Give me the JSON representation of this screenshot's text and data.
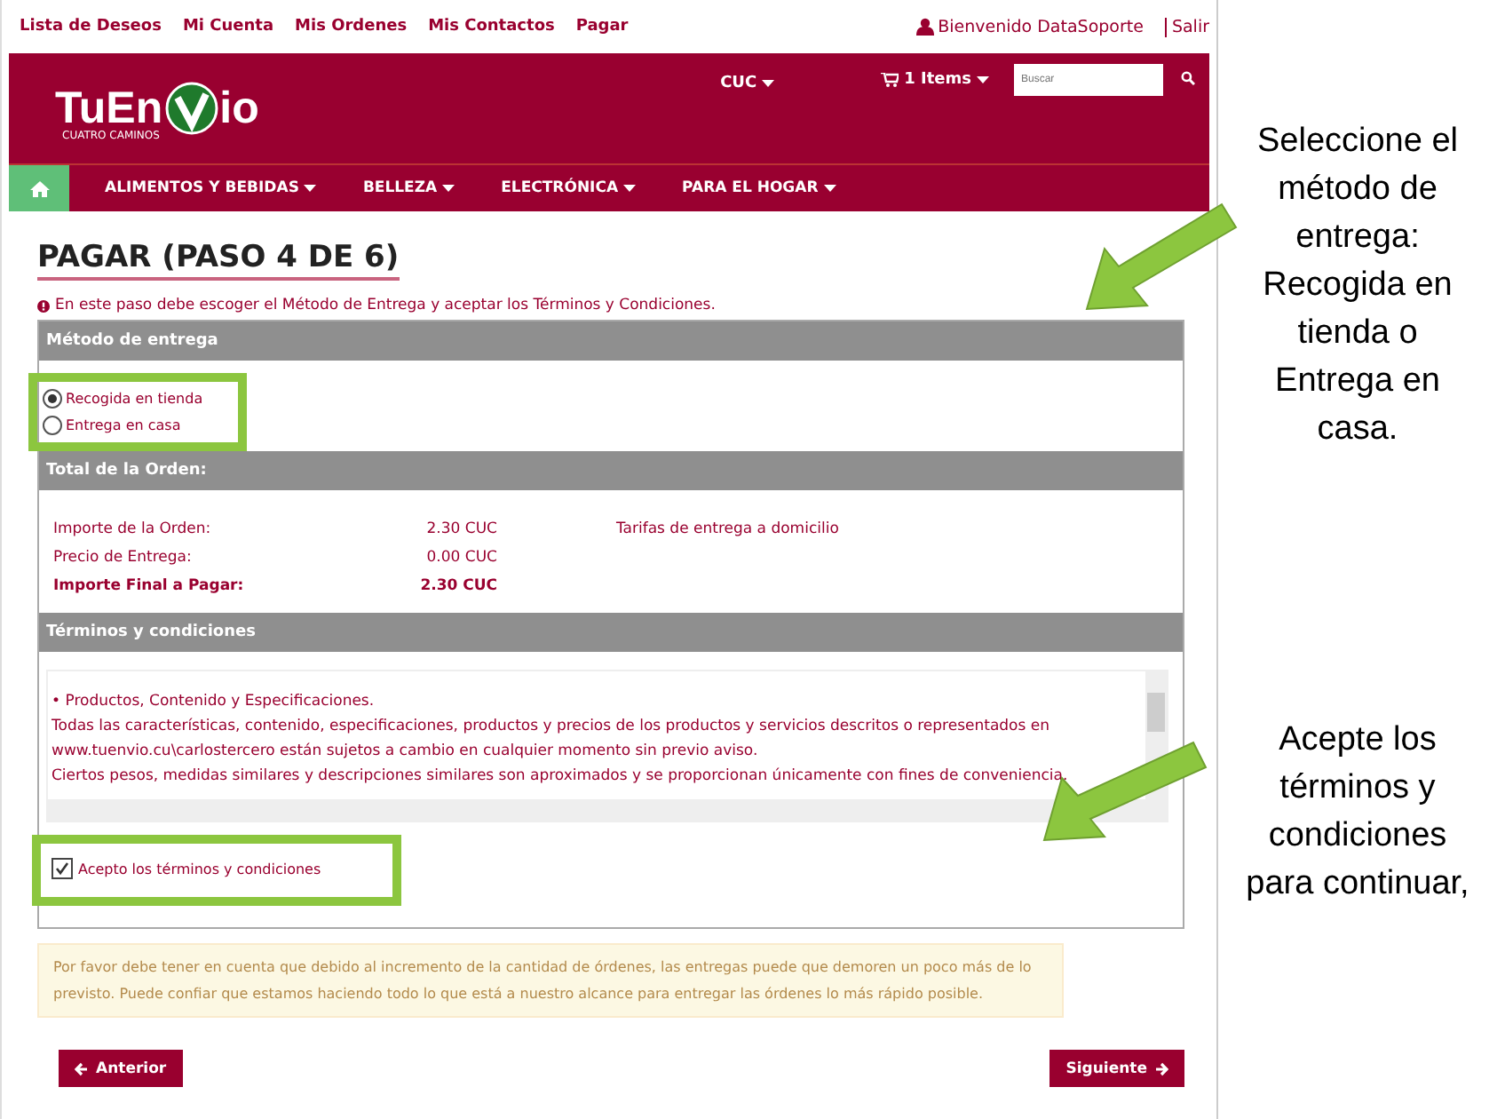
{
  "top_links": [
    "Lista de Deseos",
    "Mi Cuenta",
    "Mis Ordenes",
    "Mis Contactos",
    "Pagar"
  ],
  "user": {
    "greeting": "Bienvenido DataSoporte",
    "logout": "Salir"
  },
  "logo": {
    "text_before": "TuEn",
    "text_after": "io",
    "subtitle": "CUATRO CAMINOS"
  },
  "header": {
    "currency": "CUC",
    "cart": "1 Items",
    "search": {
      "placeholder": "Buscar"
    }
  },
  "nav": [
    "ALIMENTOS Y BEBIDAS",
    "BELLEZA",
    "ELECTRÓNICA",
    "PARA EL HOGAR"
  ],
  "title": "PAGAR (PASO 4 DE 6)",
  "info": "En este paso debe escoger el Método de Entrega y aceptar los Términos y Condiciones.",
  "delivery": {
    "heading": "Método de entrega",
    "options": [
      {
        "label": "Recogida en tienda",
        "selected": true
      },
      {
        "label": "Entrega en casa",
        "selected": false
      }
    ]
  },
  "totals": {
    "heading": "Total de la Orden:",
    "rows": [
      {
        "label": "Importe de la Orden:",
        "value": "2.30 CUC",
        "kind": "normal"
      },
      {
        "label": "Precio de Entrega:",
        "value": "0.00 CUC",
        "kind": "normal"
      },
      {
        "label": "Importe Final a Pagar:",
        "value": "2.30 CUC",
        "kind": "total"
      }
    ],
    "link": "Tarifas de entrega a domicilio"
  },
  "terms": {
    "heading": "Términos y condiciones",
    "lines": [
      "•  Productos, Contenido y Especificaciones.",
      "Todas las características, contenido, especificaciones, productos y precios de los productos y servicios descritos o representados en",
      "www.tuenvio.cu\\carlostercero están sujetos a cambio en cualquier momento sin previo aviso.",
      "Ciertos pesos, medidas similares y descripciones similares son aproximados y se proporcionan únicamente con fines de conveniencia."
    ],
    "accept": {
      "label": "Acepto los términos y condiciones",
      "checked": true
    }
  },
  "notice": "Por favor debe tener en cuenta que debido al incremento de la cantidad de órdenes, las entregas puede que demoren un poco más de lo previsto. Puede confiar que estamos haciendo todo lo que está a nuestro alcance para entregar las órdenes lo más rápido posible.",
  "buttons": {
    "previous": "Anterior",
    "next": "Siguiente"
  },
  "callouts": [
    "Seleccione el método de entrega: Recogida en tienda o Entrega en casa.",
    "Acepte los términos y condiciones para continuar,"
  ]
}
